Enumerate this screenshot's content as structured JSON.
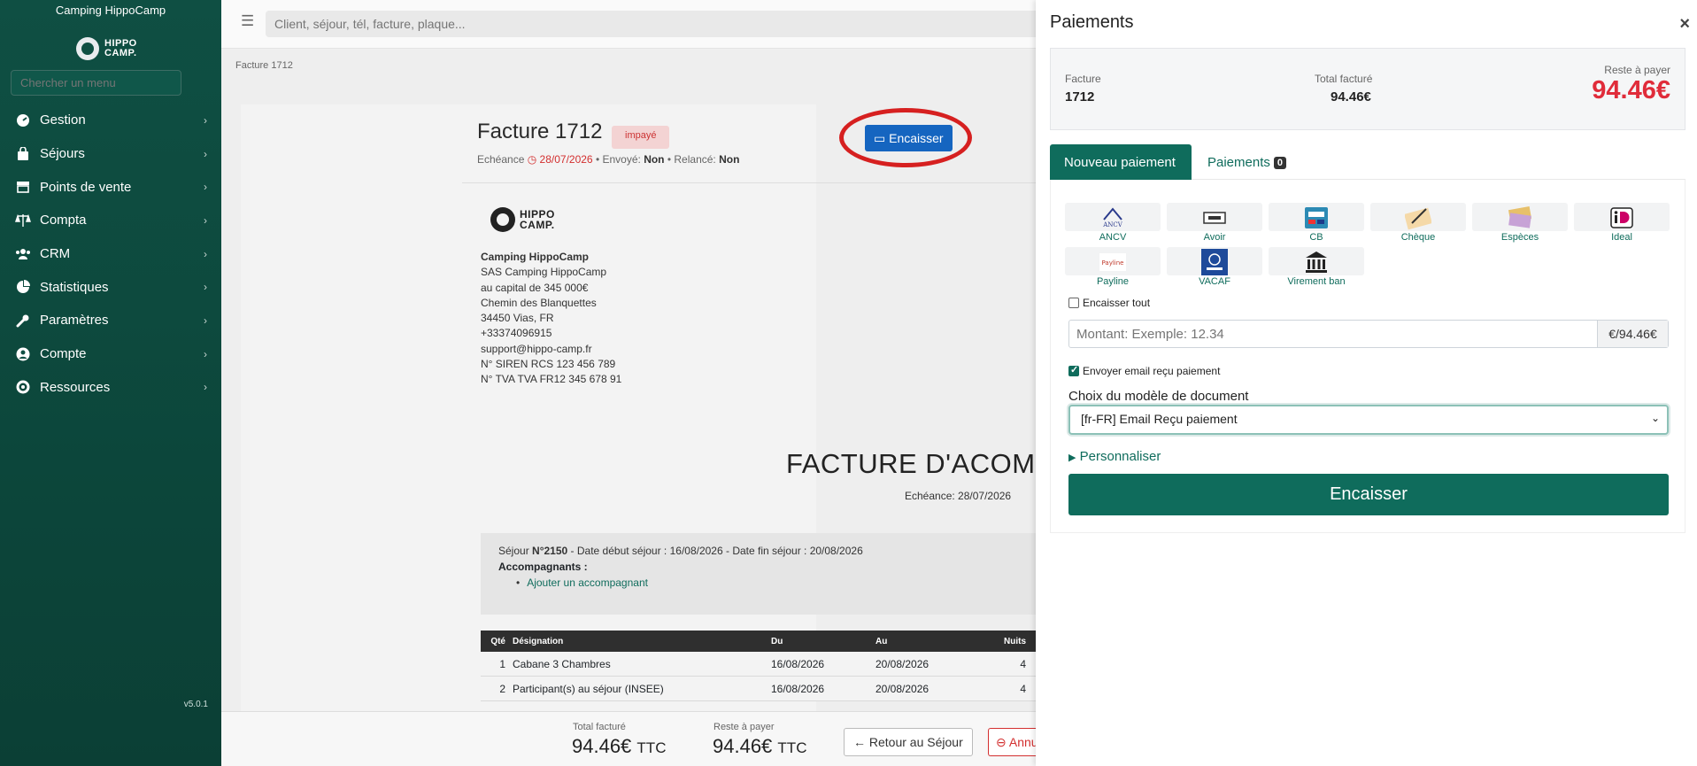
{
  "sidebar": {
    "title": "Camping HippoCamp",
    "logo": "HIPPO CAMP.",
    "search_placeholder": "Chercher un menu",
    "items": [
      {
        "label": "Gestion",
        "icon": "dashboard-icon"
      },
      {
        "label": "Séjours",
        "icon": "bag-icon"
      },
      {
        "label": "Points de vente",
        "icon": "store-icon"
      },
      {
        "label": "Compta",
        "icon": "scale-icon"
      },
      {
        "label": "CRM",
        "icon": "users-icon"
      },
      {
        "label": "Statistiques",
        "icon": "pie-chart-icon"
      },
      {
        "label": "Paramètres",
        "icon": "wrench-icon"
      },
      {
        "label": "Compte",
        "icon": "user-circle-icon"
      },
      {
        "label": "Ressources",
        "icon": "lifebuoy-icon"
      }
    ],
    "version": "v5.0.1"
  },
  "topbar": {
    "search_placeholder": "Client, séjour, tél, facture, plaque..."
  },
  "invoice": {
    "breadcrumb": "Facture 1712",
    "title": "Facture 1712",
    "status": "impayé",
    "echeance_label": "Echéance",
    "echeance_date": "28/07/2026",
    "envoye_label": "Envoyé:",
    "envoye_value": "Non",
    "relance_label": "Relancé:",
    "relance_value": "Non",
    "encaisser_btn": "Encaisser",
    "logo": "HIPPO CAMP.",
    "company": {
      "name": "Camping HippoCamp",
      "lines": [
        "SAS Camping HippoCamp",
        "au capital de 345 000€",
        "Chemin des Blanquettes",
        "34450 Vias, FR",
        "+33374096915",
        "support@hippo-camp.fr",
        "N° SIREN RCS 123 456 789",
        "N° TVA TVA FR12 345 678 91"
      ]
    },
    "doc_title": "FACTURE D'ACOMPTE",
    "doc_echeance": "Echéance: 28/07/2026",
    "sejour_prefix": "Séjour ",
    "sejour_num": "N°2150",
    "sejour_dates": " - Date début séjour : 16/08/2026 - Date fin séjour : 20/08/2026",
    "accompagnants_label": "Accompagnants :",
    "add_accompagnant": "Ajouter un accompagnant",
    "table": {
      "headers": [
        "Qté",
        "Désignation",
        "Du",
        "Au",
        "Nuits"
      ],
      "rows": [
        {
          "qty": "1",
          "des": "Cabane 3 Chambres",
          "du": "16/08/2026",
          "au": "20/08/2026",
          "nuits": "4"
        },
        {
          "qty": "2",
          "des": "Participant(s) au séjour (INSEE)",
          "du": "16/08/2026",
          "au": "20/08/2026",
          "nuits": "4"
        }
      ]
    },
    "bottom": {
      "total_label": "Total facturé",
      "total_value": "94.46€",
      "reste_label": "Reste à payer",
      "reste_value": "94.46€",
      "ttc": "TTC",
      "retour_btn": "Retour au Séjour",
      "annuler_btn": "Annuler"
    }
  },
  "panel": {
    "title": "Paiements",
    "close": "×",
    "summary": {
      "facture_label": "Facture",
      "facture_value": "1712",
      "total_label": "Total facturé",
      "total_value": "94.46€",
      "reste_label": "Reste à payer",
      "reste_value": "94.46€"
    },
    "tabs": {
      "new": "Nouveau paiement",
      "list": "Paiements",
      "count": "0"
    },
    "methods": [
      {
        "label": "ANCV",
        "icon": "ancv-logo-icon"
      },
      {
        "label": "Avoir",
        "icon": "voucher-icon"
      },
      {
        "label": "CB",
        "icon": "credit-card-icon"
      },
      {
        "label": "Chèque",
        "icon": "cheque-icon"
      },
      {
        "label": "Espèces",
        "icon": "cash-icon"
      },
      {
        "label": "Ideal",
        "icon": "ideal-logo-icon"
      },
      {
        "label": "Payline",
        "icon": "payline-logo-icon"
      },
      {
        "label": "VACAF",
        "icon": "vacaf-logo-icon"
      },
      {
        "label": "Virement ban",
        "icon": "bank-icon"
      }
    ],
    "encaisser_tout": "Encaisser tout",
    "amount_placeholder": "Montant: Exemple: 12.34",
    "amount_suffix": "€/94.46€",
    "send_email": "Envoyer email reçu paiement",
    "model_label": "Choix du modèle de document",
    "model_value": "[fr-FR] Email Reçu paiement",
    "personnaliser": "Personnaliser",
    "submit": "Encaisser"
  }
}
